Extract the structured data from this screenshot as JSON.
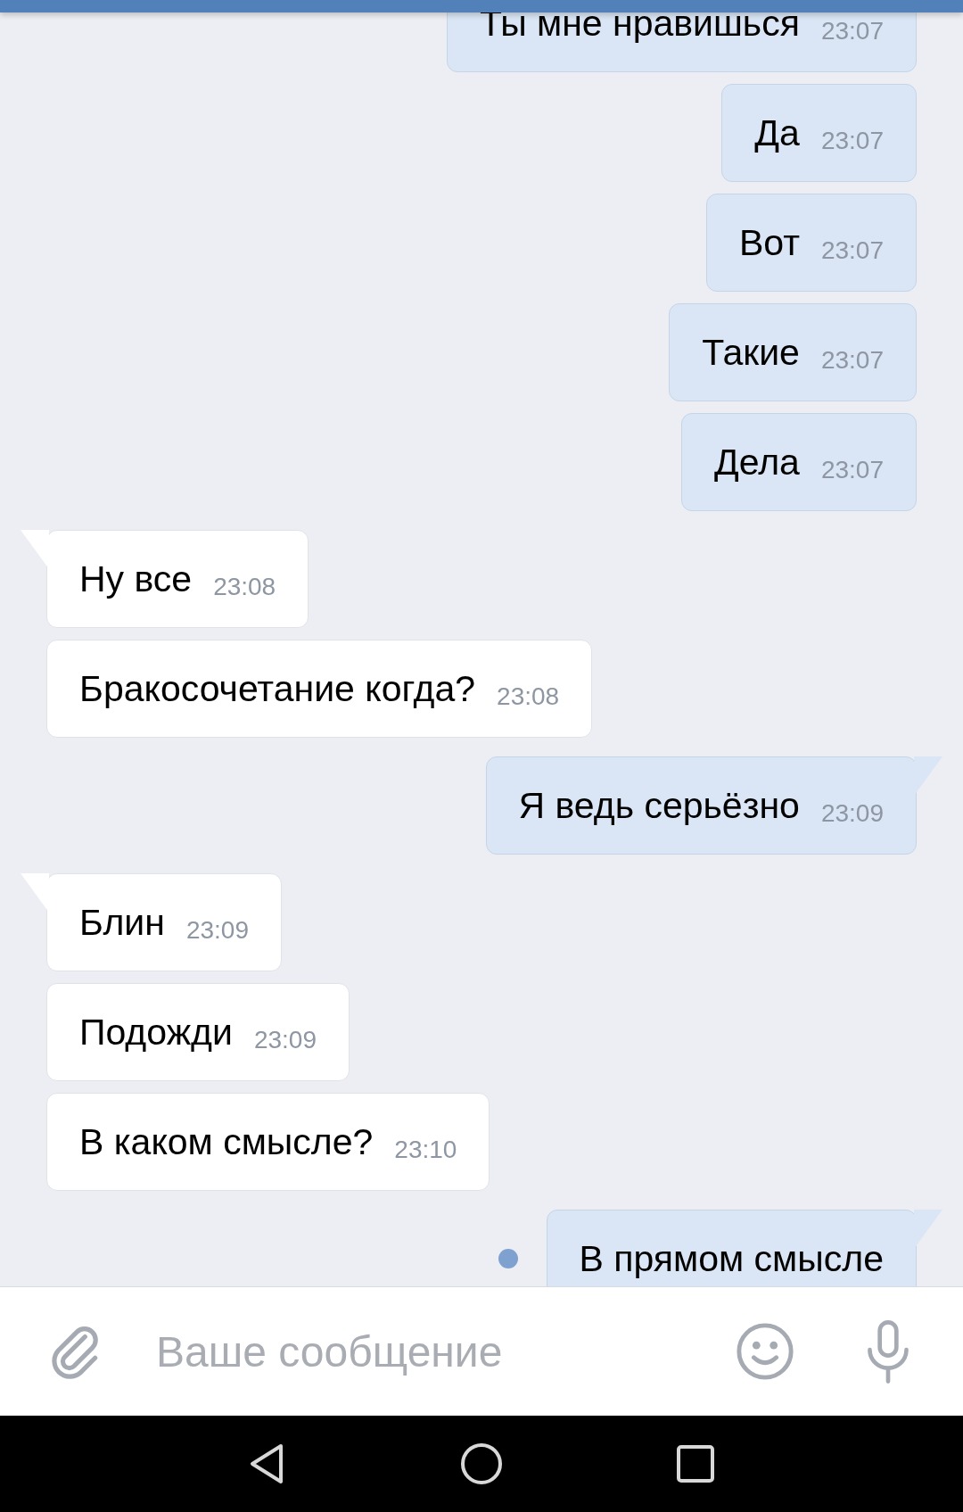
{
  "messages": [
    {
      "kind": "outgoing",
      "text": "Ты мне нравишься",
      "time": "23:07",
      "tail": false,
      "unread": false
    },
    {
      "kind": "outgoing",
      "text": "Да",
      "time": "23:07",
      "tail": false,
      "unread": false
    },
    {
      "kind": "outgoing",
      "text": "Вот",
      "time": "23:07",
      "tail": false,
      "unread": false
    },
    {
      "kind": "outgoing",
      "text": "Такие",
      "time": "23:07",
      "tail": false,
      "unread": false
    },
    {
      "kind": "outgoing",
      "text": "Дела",
      "time": "23:07",
      "tail": false,
      "unread": false
    },
    {
      "kind": "incoming",
      "text": "Ну все",
      "time": "23:08",
      "tail": true,
      "unread": false
    },
    {
      "kind": "incoming",
      "text": "Бракосочетание когда?",
      "time": "23:08",
      "tail": false,
      "unread": false
    },
    {
      "kind": "outgoing",
      "text": "Я ведь серьёзно",
      "time": "23:09",
      "tail": true,
      "unread": false
    },
    {
      "kind": "incoming",
      "text": "Блин",
      "time": "23:09",
      "tail": true,
      "unread": false
    },
    {
      "kind": "incoming",
      "text": "Подожди",
      "time": "23:09",
      "tail": false,
      "unread": false
    },
    {
      "kind": "incoming",
      "text": "В каком смысле?",
      "time": "23:10",
      "tail": false,
      "unread": false
    },
    {
      "kind": "outgoing",
      "text": "В прямом смысле",
      "tail": true,
      "unread": true
    }
  ],
  "composer": {
    "placeholder": "Ваше сообщение"
  }
}
